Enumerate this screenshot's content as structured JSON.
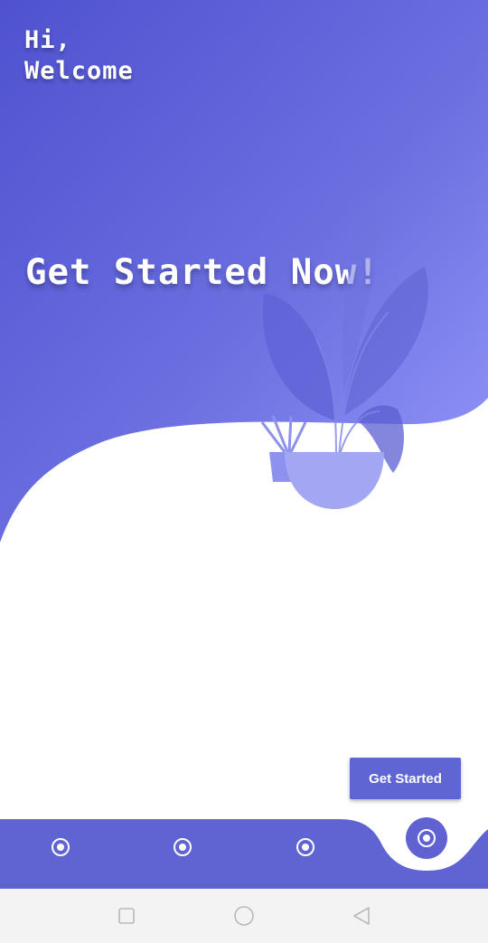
{
  "header": {
    "greeting_line1": "Hi,",
    "greeting_line2": "Welcome"
  },
  "hero": {
    "headline": "Get Started Now!",
    "illustration": "potted-plant-illustration"
  },
  "cta": {
    "label": "Get Started"
  },
  "bottom_nav": {
    "items": [
      {
        "icon": "radio-dot-icon"
      },
      {
        "icon": "radio-dot-icon"
      },
      {
        "icon": "radio-dot-icon"
      }
    ],
    "active_item": {
      "icon": "radio-dot-icon"
    }
  },
  "system_nav": {
    "buttons": [
      "recents-square-icon",
      "home-circle-icon",
      "back-triangle-icon"
    ]
  },
  "colors": {
    "gradient_start": "#4f52cf",
    "gradient_end": "#8c90f5",
    "accent": "#5f62d0",
    "nav_bar": "#6064d2",
    "system_bar": "#f3f3f3"
  }
}
